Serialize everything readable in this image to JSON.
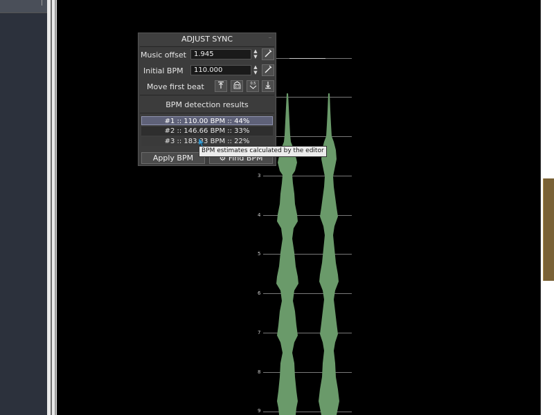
{
  "panel": {
    "title": "ADJUST SYNC",
    "music_offset": {
      "label": "Music offset",
      "value": "1.945"
    },
    "initial_bpm": {
      "label": "Initial BPM",
      "value": "110.000"
    },
    "move_first_beat": {
      "label": "Move first beat",
      "icons": [
        "arrow-up-icon",
        "bar-0.5-icon",
        "beat-0.5-icon",
        "arrow-down-icon"
      ]
    },
    "results_title": "BPM detection results",
    "results": [
      "#1 :: 110.00 BPM :: 44%",
      "#2 :: 146.66 BPM :: 33%",
      "#3 :: 183.33 BPM :: 22%"
    ],
    "apply_label": "Apply BPM",
    "find_label": "Find BPM"
  },
  "tooltip": "BPM estimates calculated by the editor",
  "beat_numbers": [
    "3",
    "4",
    "5",
    "6",
    "7",
    "8",
    "9"
  ],
  "colors": {
    "wave": "#6a9a6a",
    "panel_bg": "#3c3c3c",
    "selected_row": "#5e6178",
    "scrollbar": "#7a6236"
  }
}
